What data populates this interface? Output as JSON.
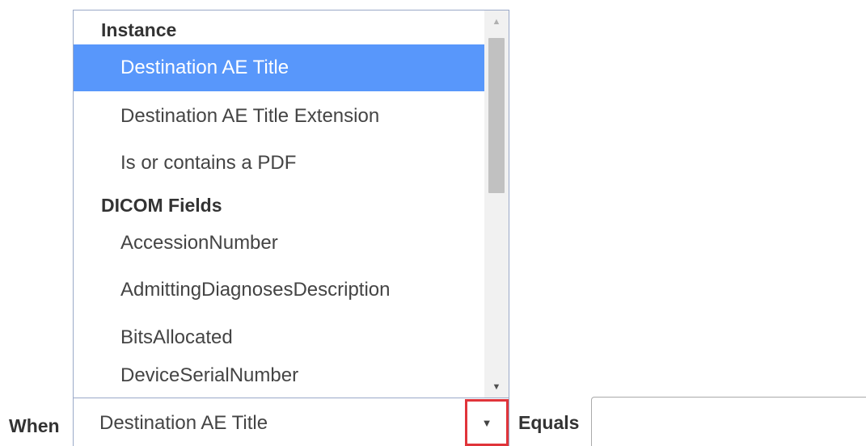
{
  "dropdown": {
    "groups": [
      {
        "label": "Instance",
        "options": [
          {
            "label": "Destination AE Title",
            "selected": true
          },
          {
            "label": "Destination AE Title Extension",
            "selected": false
          },
          {
            "label": "Is or contains a PDF",
            "selected": false
          }
        ]
      },
      {
        "label": "DICOM Fields",
        "options": [
          {
            "label": "AccessionNumber",
            "selected": false
          },
          {
            "label": "AdmittingDiagnosesDescription",
            "selected": false
          },
          {
            "label": "BitsAllocated",
            "selected": false
          },
          {
            "label": "DeviceSerialNumber",
            "selected": false
          }
        ]
      }
    ],
    "scroll_up_icon": "▲",
    "scroll_down_icon": "▼"
  },
  "condition": {
    "when_label": "When",
    "selected_value": "Destination AE Title",
    "arrow_icon": "▼",
    "equals_label": "Equals",
    "equals_value": ""
  },
  "colors": {
    "selected_bg": "#5897fb",
    "highlight_border": "#e0343a"
  }
}
